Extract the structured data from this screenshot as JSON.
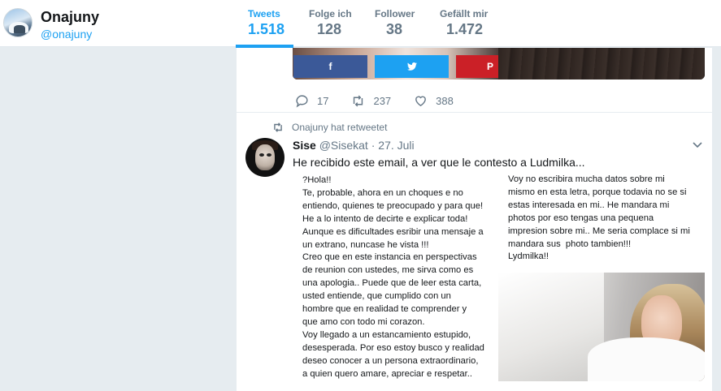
{
  "profile": {
    "name": "Onajuny",
    "handle": "@onajuny"
  },
  "stats": [
    {
      "label": "Tweets",
      "value": "1.518",
      "active": true
    },
    {
      "label": "Folge ich",
      "value": "128",
      "active": false
    },
    {
      "label": "Follower",
      "value": "38",
      "active": false
    },
    {
      "label": "Gefällt mir",
      "value": "1.472",
      "active": false
    }
  ],
  "prev_tweet": {
    "share_buttons": {
      "facebook": "f",
      "twitter": "twitter-bird-icon",
      "pinterest": "P"
    },
    "actions": {
      "replies": "17",
      "retweets": "237",
      "likes": "388"
    }
  },
  "tweet": {
    "retweet_context": "Onajuny hat retweetet",
    "name": "Sise",
    "handle": "@Sisekat",
    "separator": "·",
    "date": "27. Juli",
    "text": "He recibido este email, a ver que le contesto a Ludmilka...",
    "letter_left": "?Hola!!\nTe, probable, ahora en un choques e no\nentiendo, quienes te preocupado y para que!\nHe a lo intento de decirte e explicar toda!\nAunque es dificultades esribir una mensaje a\nun extrano, nuncase he vista !!!\nCreo que en este instancia en perspectivas\nde reunion con ustedes, me sirva como es\nuna apologia.. Puede que de leer esta carta,\nusted entiende, que cumplido con un\nhombre que en realidad te comprender y\nque amo con todo mi corazon.\nVoy llegado a un estancamiento estupido,\ndesesperada. Por eso estoy busco y realidad\ndeseo conocer a un persona extraordinario,\na quien quero amare, apreciar e respetar..",
    "letter_right": "Voy no escribira mucha datos sobre mi\nmismo en esta letra, porque todavia no se si\nestas interesada en mi.. He mandara mi\nphotos por eso tengas una pequena\nimpresion sobre mi.. Me seria complace si mi\nmandara sus  photo tambien!!!\nLydmilka!!"
  },
  "icons": [
    "reply-icon",
    "retweet-icon",
    "like-icon",
    "retweet-small-icon",
    "chevron-down-icon"
  ],
  "colors": {
    "accent": "#1da1f2",
    "muted": "#657786",
    "facebook": "#3b5998",
    "pinterest": "#cb2027",
    "background": "#e6ecf0"
  }
}
